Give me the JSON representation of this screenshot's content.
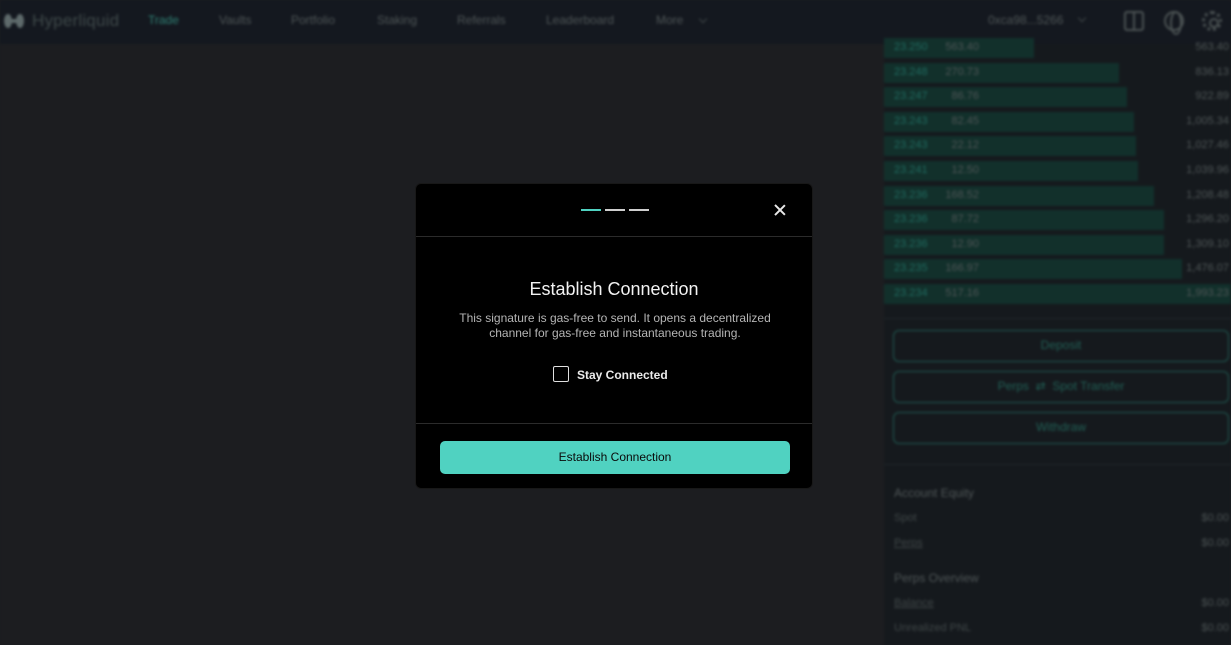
{
  "app": {
    "logo_text": "Hyperliquid",
    "nav": [
      "Trade",
      "Vaults",
      "Portfolio",
      "Staking",
      "Referrals",
      "Leaderboard",
      "More"
    ],
    "active_nav": "Trade",
    "account": "0xca98...5266"
  },
  "order_book": [
    {
      "price": "23.250",
      "size": "563.40",
      "total": "563.40",
      "depth": 0.0
    },
    {
      "price": "23.248",
      "size": "270.73",
      "total": "836.13",
      "depth": 0.43
    },
    {
      "price": "23.247",
      "size": "86.76",
      "total": "922.89",
      "depth": 0.47
    },
    {
      "price": "23.243",
      "size": "82.45",
      "total": "1,005.34",
      "depth": 0.51
    },
    {
      "price": "23.243",
      "size": "22.12",
      "total": "1,027.46",
      "depth": 0.52
    },
    {
      "price": "23.241",
      "size": "12.50",
      "total": "1,039.96",
      "depth": 0.53
    },
    {
      "price": "23.236",
      "size": "168.52",
      "total": "1,208.48",
      "depth": 0.61
    },
    {
      "price": "23.236",
      "size": "87.72",
      "total": "1,296.20",
      "depth": 0.66
    },
    {
      "price": "23.236",
      "size": "12.90",
      "total": "1,309.10",
      "depth": 0.66
    },
    {
      "price": "23.235",
      "size": "166.97",
      "total": "1,476.07",
      "depth": 0.75
    },
    {
      "price": "23.234",
      "size": "517.16",
      "total": "1,993.23",
      "depth": 1.0
    }
  ],
  "panel": {
    "deposit": "Deposit",
    "perps_label": "Perps",
    "transfer_icon": "arrows-icon",
    "spot_transfer": "Spot Transfer",
    "withdraw": "Withdraw",
    "account_equity": "Account Equity",
    "spot_label": "Spot",
    "spot_value": "$0.00",
    "perps_value": "$0.00",
    "perps_overview": "Perps Overview",
    "balance_label": "Balance",
    "balance_value": "$0.00",
    "upnl_label": "Unrealized PNL",
    "upnl_value": "$0.00"
  },
  "modal": {
    "steps": 3,
    "active_step": 1,
    "title": "Establish Connection",
    "description": "This signature is gas-free to send. It opens a decentralized channel for gas-free and instantaneous trading.",
    "checkbox_label": "Stay Connected",
    "checkbox_checked": false,
    "button_label": "Establish Connection",
    "accent_color": "#50d2c1"
  }
}
